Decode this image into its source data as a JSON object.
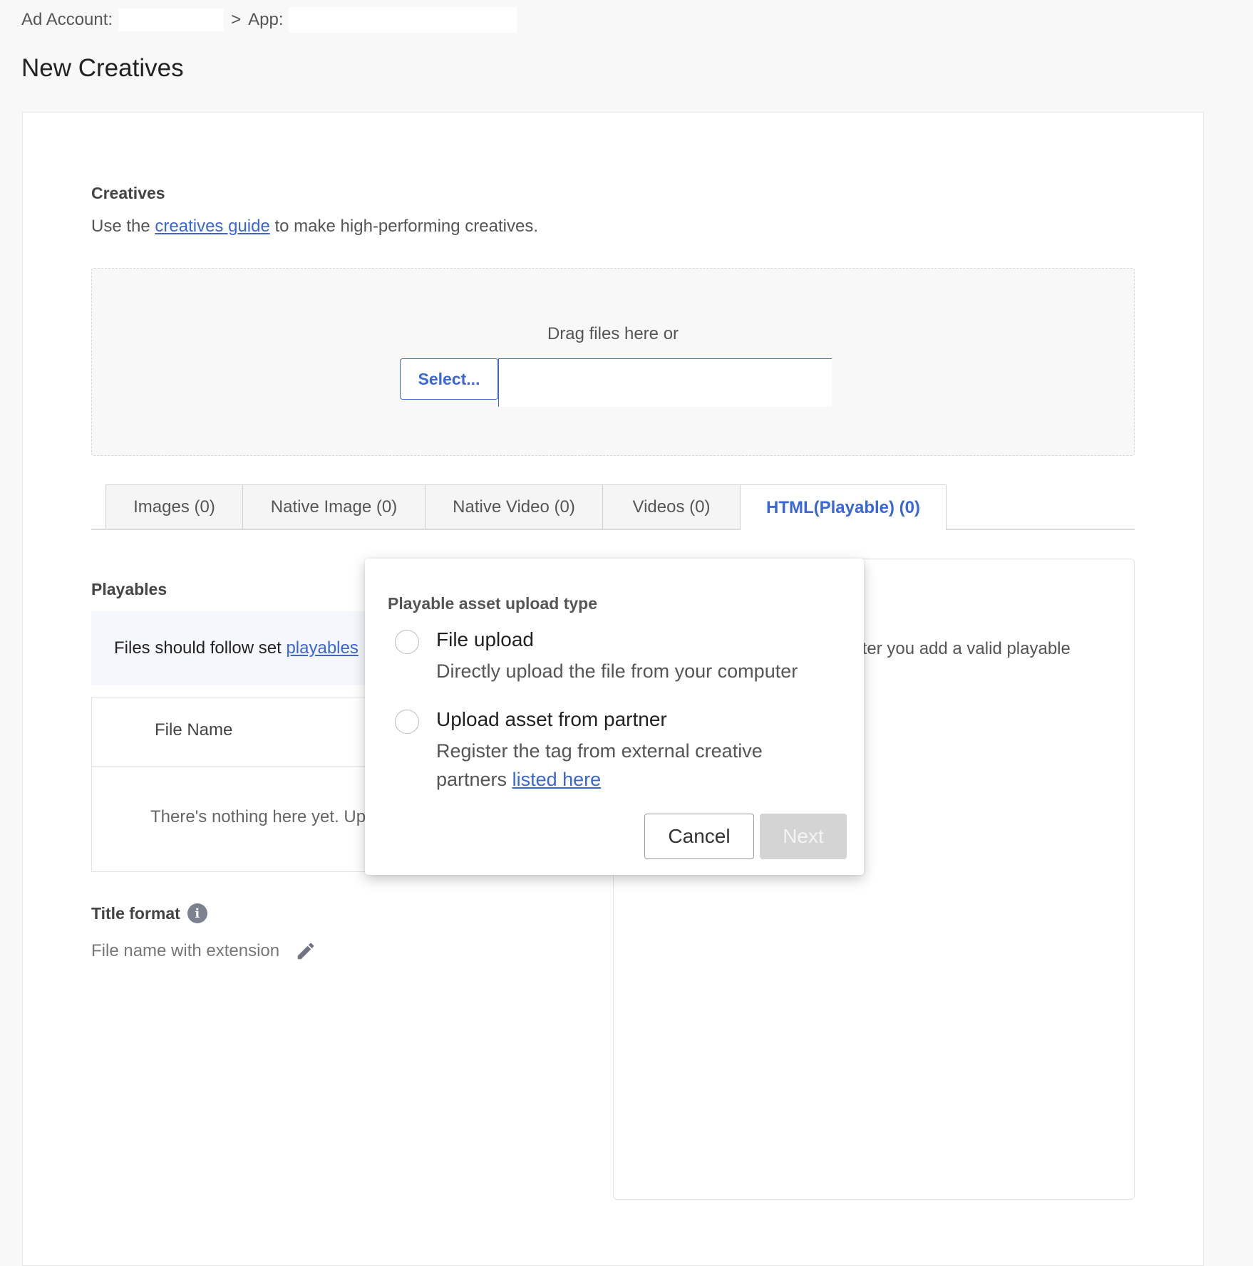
{
  "breadcrumb": {
    "ad_account_label": "Ad Account:",
    "separator": ">",
    "app_label": "App:"
  },
  "page_title": "New Creatives",
  "creatives": {
    "heading": "Creatives",
    "guide_prefix": "Use the",
    "guide_link": "creatives guide",
    "guide_suffix": "to make high-performing creatives."
  },
  "dropzone": {
    "drag_text": "Drag files here or",
    "select_label": "Select..."
  },
  "tabs": [
    {
      "label": "Images (0)"
    },
    {
      "label": "Native Image (0)"
    },
    {
      "label": "Native Video (0)"
    },
    {
      "label": "Videos (0)"
    },
    {
      "label": "HTML(Playable) (0)"
    }
  ],
  "playables": {
    "heading": "Playables",
    "info_prefix": "Files should follow set",
    "info_link": "playables",
    "table_header": "File Name",
    "empty_text": "There's nothing here yet. Up"
  },
  "preview": {
    "partial_text": "fter you add a valid playable"
  },
  "title_format": {
    "label": "Title format",
    "value": "File name with extension"
  },
  "modal": {
    "title": "Playable asset upload type",
    "options": [
      {
        "title": "File upload",
        "desc": "Directly upload the file from your computer"
      },
      {
        "title": "Upload asset from partner",
        "desc_line1": "Register the tag from external creative",
        "desc_prefix": "partners",
        "desc_link": "listed here"
      }
    ],
    "cancel_label": "Cancel",
    "next_label": "Next"
  },
  "colors": {
    "accent": "#3a66d6",
    "disabled": "#d4d4d4"
  }
}
